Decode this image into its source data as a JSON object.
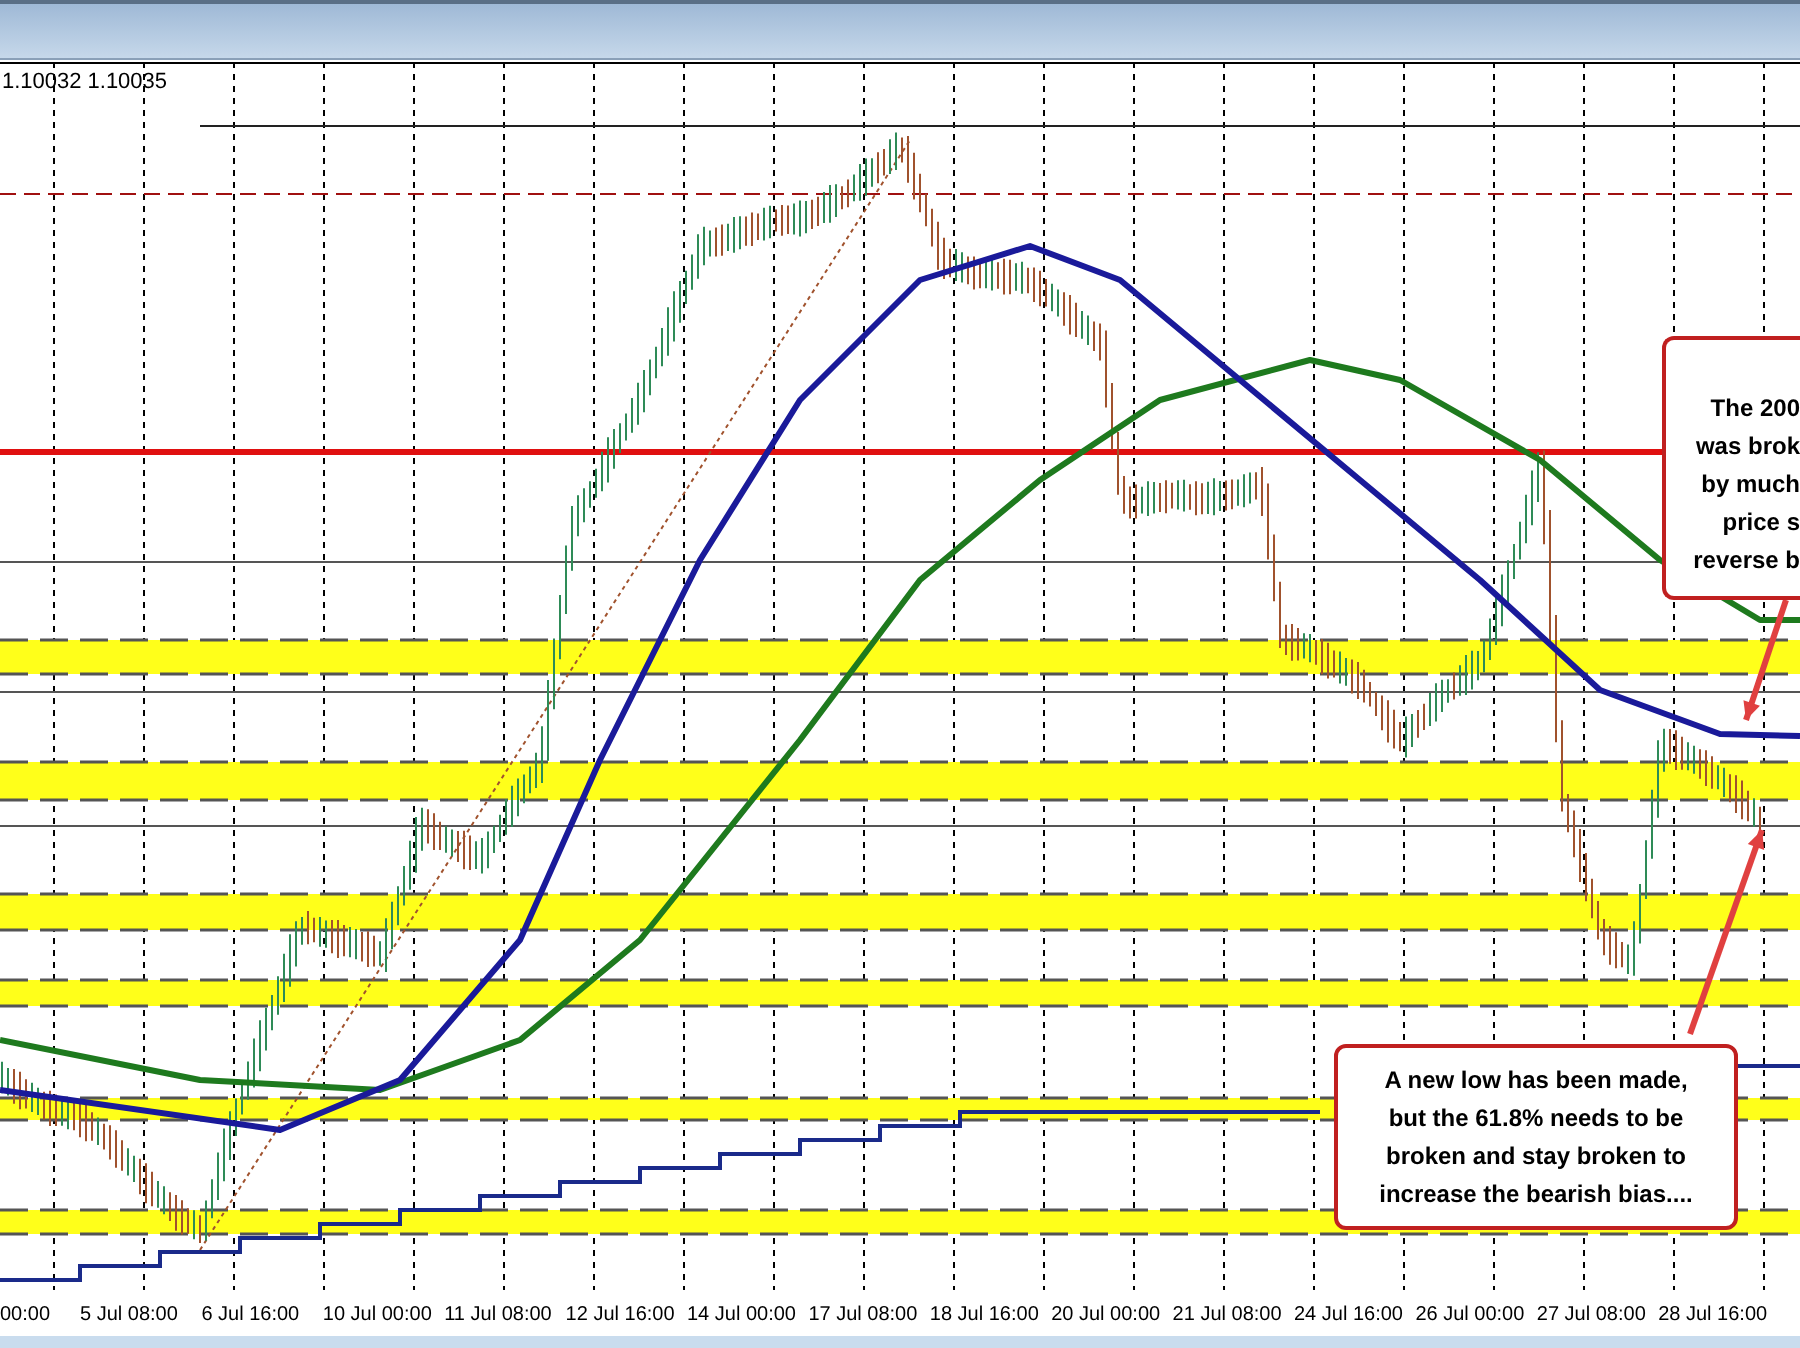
{
  "price_readout": [
    "1.10032",
    "1.10035"
  ],
  "x_axis_labels": [
    "00:00",
    "5 Jul 08:00",
    "6 Jul 16:00",
    "10 Jul 00:00",
    "11 Jul 08:00",
    "12 Jul 16:00",
    "14 Jul 00:00",
    "17 Jul 08:00",
    "18 Jul 16:00",
    "20 Jul 00:00",
    "21 Jul 08:00",
    "24 Jul 16:00",
    "26 Jul 00:00",
    "27 Jul 08:00",
    "28 Jul 16:00"
  ],
  "callouts": [
    {
      "kind": "cut",
      "lines": [
        "The 200",
        "was brok",
        "by much",
        "price s",
        "reverse b"
      ]
    },
    {
      "kind": "full",
      "lines": [
        "A new low has been made,",
        "but the 61.8% needs to be",
        "broken and stay broken to",
        "increase the bearish bias...."
      ]
    }
  ]
}
